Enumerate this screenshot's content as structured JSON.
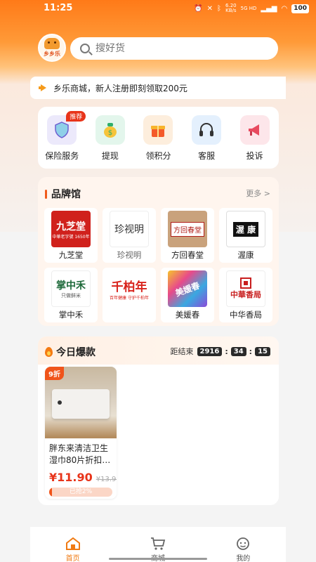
{
  "status_bar": {
    "time": "11:25",
    "network_speed_value": "6.20",
    "network_speed_unit": "KB/s",
    "network_type": "5G HD",
    "battery": "100"
  },
  "header": {
    "logo_text": "乡乡乐",
    "search_placeholder": "搜好货"
  },
  "notice": {
    "text": "乡乐商城，新人注册即刻领取200元"
  },
  "services": [
    {
      "label": "保险服务",
      "icon": "shield-icon",
      "badge": "推荐",
      "bg": "#ece9fb",
      "color": "#7a6ad8"
    },
    {
      "label": "提现",
      "icon": "money-bag-icon",
      "bg": "#e3f6ec",
      "color": "#2fae6a"
    },
    {
      "label": "领积分",
      "icon": "gift-icon",
      "bg": "#fdeedd",
      "color": "#f08a1e"
    },
    {
      "label": "客服",
      "icon": "headset-icon",
      "bg": "#e4f0fd",
      "color": "#3a6ed8"
    },
    {
      "label": "投诉",
      "icon": "megaphone-icon",
      "bg": "#fde6ea",
      "color": "#e84a5f"
    }
  ],
  "brands": {
    "title": "品牌馆",
    "more": "更多 >",
    "items": [
      {
        "name": "九芝堂",
        "logo_text": "九芝堂",
        "logo_sub": "中華老字號 1650年"
      },
      {
        "name": "珍视明",
        "logo_text": "珍视明"
      },
      {
        "name": "方回春堂",
        "logo_text": "方回春堂"
      },
      {
        "name": "渥康",
        "logo_text": "渥 康"
      },
      {
        "name": "掌中禾",
        "logo_text": "掌中禾",
        "logo_sub": "只做鲜米"
      },
      {
        "name": "千柏年",
        "logo_text": "千柏年",
        "logo_sub": "百年健康 守护千柏年"
      },
      {
        "name": "美媛春",
        "logo_text": "美媛春"
      },
      {
        "name": "中华香局",
        "logo_text": "中華香局"
      }
    ]
  },
  "hot": {
    "title": "今日爆款",
    "countdown_label": "距结束",
    "countdown": [
      "2916",
      "34",
      "15"
    ],
    "products": [
      {
        "badge": "9折",
        "name": "胖东来清洁卫生湿巾80片折扣…",
        "price": "¥11.90",
        "original_price": "¥13.90",
        "progress_text": "已抢2%",
        "progress": 0.02
      }
    ]
  },
  "tabbar": [
    {
      "label": "首页",
      "icon": "home-icon",
      "active": true
    },
    {
      "label": "商城",
      "icon": "cart-icon",
      "active": false
    },
    {
      "label": "我的",
      "icon": "profile-icon",
      "active": false
    }
  ],
  "colors": {
    "accent": "#f07a12",
    "price": "#e8341a"
  }
}
